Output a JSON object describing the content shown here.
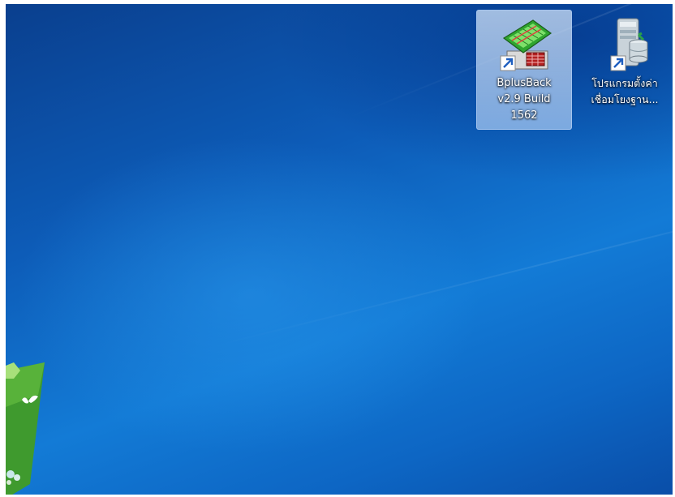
{
  "desktop": {
    "icons": [
      {
        "label_lines": [
          "BplusBack",
          "v2.9 Build",
          "1562"
        ],
        "selected": true,
        "icon": "spreadsheet-shortcut-icon"
      },
      {
        "label_lines": [
          "โปรแกรมตั้งค่า",
          "เชื่อมโยงฐาน..."
        ],
        "selected": false,
        "icon": "database-server-shortcut-icon"
      }
    ],
    "colors": {
      "wallpaper_dark": "#0a3f8e",
      "wallpaper_light": "#137bd6",
      "selection": "#cfe3fb",
      "logo_green": "#3f9a2e"
    }
  }
}
